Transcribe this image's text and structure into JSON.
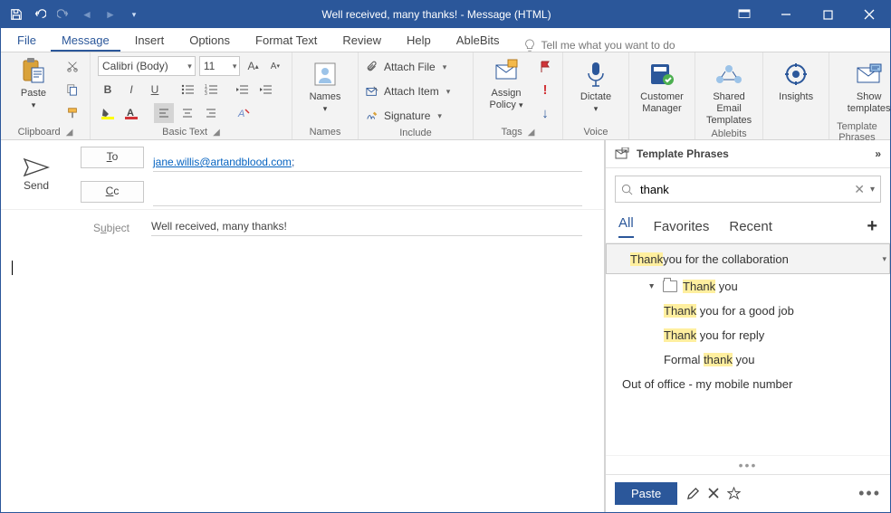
{
  "title": "Well received, many thanks!  -  Message (HTML)",
  "tabs": [
    "File",
    "Message",
    "Insert",
    "Options",
    "Format Text",
    "Review",
    "Help",
    "AbleBits"
  ],
  "tellme": "Tell me what you want to do",
  "clipboard": {
    "paste": "Paste",
    "label": "Clipboard"
  },
  "basictext": {
    "font": "Calibri (Body)",
    "size": "11",
    "label": "Basic Text"
  },
  "names": {
    "label": "Names",
    "btn": "Names"
  },
  "include": {
    "attach_file": "Attach File",
    "attach_item": "Attach Item",
    "signature": "Signature",
    "label": "Include"
  },
  "tags": {
    "assign": "Assign",
    "policy": "Policy",
    "label": "Tags"
  },
  "voice": {
    "dictate": "Dictate",
    "label": "Voice"
  },
  "cm": {
    "l1": "Customer",
    "l2": "Manager"
  },
  "ablebits": {
    "l1": "Shared Email",
    "l2": "Templates",
    "label": "Ablebits"
  },
  "insights": "Insights",
  "tp": {
    "l1": "Show",
    "l2": "templates",
    "label": "Template Phrases"
  },
  "send": "Send",
  "to_label": "To",
  "cc_label": "Cc",
  "subject_label": "Subject",
  "to_value": "jane.willis@artandblood.com",
  "subject_value": "Well received, many thanks!",
  "panel": {
    "title": "Template Phrases",
    "search": "thank",
    "tabs": {
      "all": "All",
      "fav": "Favorites",
      "recent": "Recent"
    },
    "paste": "Paste",
    "items": [
      {
        "pre": "",
        "hl": "Thank",
        "post": " you for the collaboration"
      },
      {
        "pre": "",
        "hl": "Thank",
        "post": " you"
      },
      {
        "pre": "",
        "hl": "Thank",
        "post": " you for a good job"
      },
      {
        "pre": "",
        "hl": "Thank",
        "post": " you for reply"
      },
      {
        "pre": "Formal ",
        "hl": "thank",
        "post": " you"
      }
    ],
    "extra": "Out of office - my mobile number"
  }
}
